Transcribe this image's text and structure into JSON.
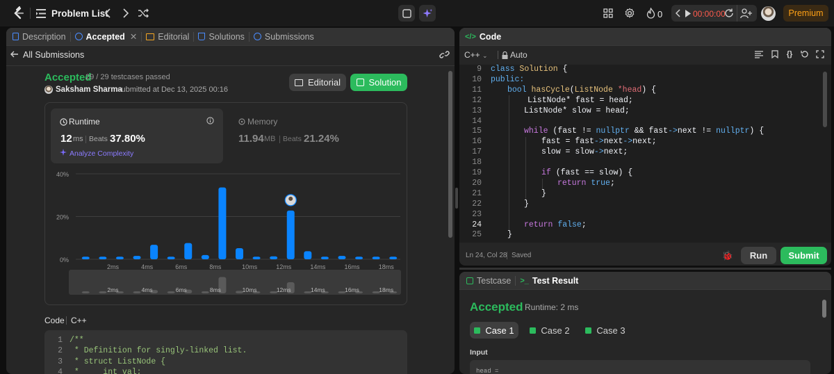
{
  "topbar": {
    "problem_list": "Problem List",
    "streak": "0",
    "timer": "00:00:00",
    "premium": "Premium"
  },
  "left": {
    "tabs": [
      "Description",
      "Accepted",
      "Editorial",
      "Solutions",
      "Submissions"
    ],
    "all_submissions": "All Submissions",
    "status": "Accepted",
    "testcases": "29 / 29 testcases passed",
    "user": "Saksham Sharma",
    "submitted_at": "submitted at Dec 13, 2025 00:16",
    "editorial_btn": "Editorial",
    "solution_btn": "Solution",
    "runtime": {
      "label": "Runtime",
      "value": "12",
      "unit": "ms",
      "beats_label": "Beats",
      "beats": "37.80%",
      "analyze": "Analyze Complexity"
    },
    "memory": {
      "label": "Memory",
      "value": "11.94",
      "unit": "MB",
      "beats_label": "Beats",
      "beats": "21.24%"
    },
    "code_label": "Code",
    "code_lang": "C++",
    "code_lines": [
      {
        "n": "1",
        "t": "/**"
      },
      {
        "n": "2",
        "t": " * Definition for singly-linked list."
      },
      {
        "n": "3",
        "t": " * struct ListNode {"
      },
      {
        "n": "4",
        "t": " *     int val;"
      }
    ]
  },
  "chart_data": {
    "type": "bar",
    "ylim": [
      0,
      40
    ],
    "yticks": [
      "40%",
      "20%",
      "0%"
    ],
    "xticks": [
      "2ms",
      "4ms",
      "6ms",
      "8ms",
      "10ms",
      "12ms",
      "14ms",
      "16ms",
      "18ms"
    ],
    "values": [
      1.2,
      1.2,
      1.2,
      1.6,
      6.8,
      1.2,
      7.6,
      2.0,
      33.6,
      5.2,
      1.2,
      1.4,
      22.8,
      3.8,
      1.2,
      1.6,
      1.2,
      1.2,
      1.2
    ],
    "highlight_index": 12,
    "minimap_values": [
      1.2,
      1.2,
      1.2,
      1.6,
      6.8,
      1.2,
      7.6,
      2.0,
      33.6,
      5.2,
      1.2,
      1.4,
      22.8,
      3.8,
      1.2,
      1.6,
      1.2,
      1.2,
      1.2
    ],
    "bar_color": "#0a84ff"
  },
  "editor": {
    "title": "Code",
    "lang": "C++",
    "mode": "Auto",
    "status_pos": "Ln 24, Col 28",
    "status_saved": "Saved",
    "run": "Run",
    "submit": "Submit",
    "lines": [
      {
        "n": "9"
      },
      {
        "n": "10"
      },
      {
        "n": "11"
      },
      {
        "n": "12"
      },
      {
        "n": "13"
      },
      {
        "n": "14"
      },
      {
        "n": "15"
      },
      {
        "n": "16"
      },
      {
        "n": "17"
      },
      {
        "n": "18"
      },
      {
        "n": "19"
      },
      {
        "n": "20"
      },
      {
        "n": "21"
      },
      {
        "n": "22"
      },
      {
        "n": "23"
      },
      {
        "n": "24"
      },
      {
        "n": "25"
      }
    ],
    "tokens": {
      "class": "class",
      "Solution": "Solution",
      "brace_open": " {",
      "public": "public:",
      "bool": "bool",
      "hasCycle": "hasCycle",
      "sig_open": "(",
      "ListNode": "ListNode",
      "ptr_head": " *head",
      "sig_close": ") {",
      "l12": "ListNode* fast = head;",
      "l13": "ListNode* slow = head;",
      "while": "while",
      "l15_a": " (fast != ",
      "nullptr": "nullptr",
      "l15_b": " && fast",
      "arrow": "->",
      "next": "next",
      "l15_c": " != ",
      "nullptr2": "nullptr",
      "l15_d": ") {",
      "l16_a": "fast = ",
      "fast": "fast",
      "l16_b": "next",
      "l16_c": "next",
      "l16_d": ";",
      "l17_a": "slow = ",
      "slow": "slow",
      "l17_b": "next",
      "l17_c": ";",
      "if": "if",
      "l19": " (fast == slow) {",
      "return": "return",
      "true": "true",
      "semi": ";",
      "rbrace": "}",
      "return2": "return",
      "false": "false",
      "semi2": ";",
      "rbrace2": "}"
    }
  },
  "result": {
    "tab_testcase": "Testcase",
    "tab_result": "Test Result",
    "status": "Accepted",
    "runtime": "Runtime: 2 ms",
    "cases": [
      "Case 1",
      "Case 2",
      "Case 3"
    ],
    "input_label": "Input",
    "input_value": "head ="
  }
}
